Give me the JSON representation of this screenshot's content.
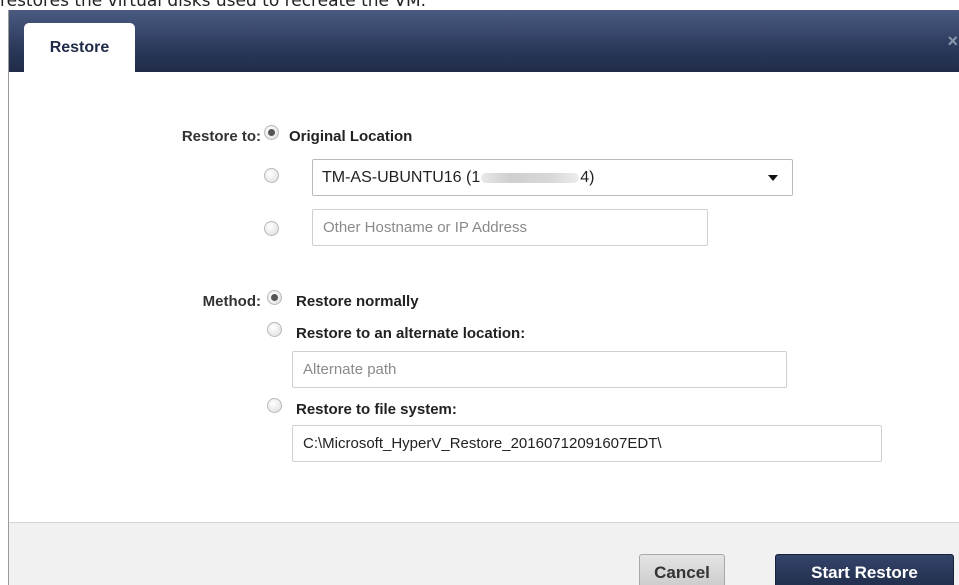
{
  "caption_text": "restores the virtual disks used to recreate the VM.",
  "dialog": {
    "tab_label": "Restore",
    "close_symbol": "×"
  },
  "restore_to": {
    "label": "Restore to:",
    "options": {
      "original_location": "Original Location",
      "host_select_prefix": "TM-AS-UBUNTU16 (1",
      "host_select_suffix": "4)",
      "other_host_placeholder": "Other Hostname or IP Address"
    },
    "selected": "original_location"
  },
  "method": {
    "label": "Method:",
    "options": {
      "normal": "Restore normally",
      "alternate": "Restore to an alternate location:",
      "alternate_placeholder": "Alternate path",
      "file_system": "Restore to file system:",
      "file_system_path": "C:\\Microsoft_HyperV_Restore_20160712091607EDT\\"
    },
    "selected": "normal"
  },
  "footer": {
    "cancel_label": "Cancel",
    "start_label": "Start Restore"
  },
  "colors": {
    "titlebar": "#2c3a5c",
    "primary_button": "#1f2b48"
  },
  "icons": {
    "close": "close-icon",
    "dropdown": "chevron-down-icon"
  }
}
